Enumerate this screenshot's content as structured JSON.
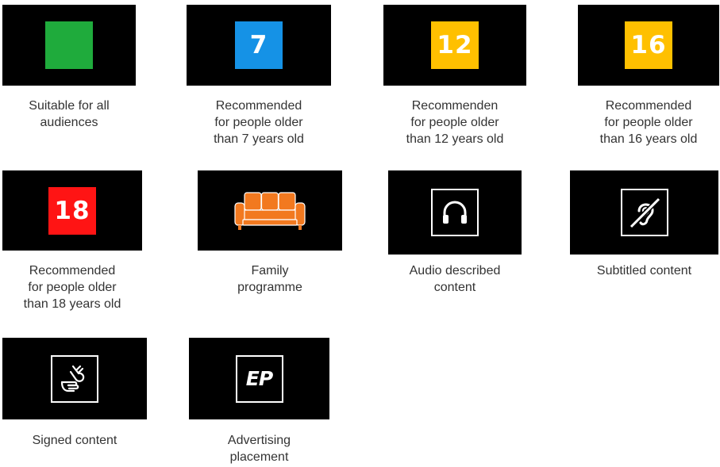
{
  "colors": {
    "green": "#1fab3c",
    "blue": "#1592e6",
    "yellow": "#ffc000",
    "red": "#ff1414",
    "sofa": "#f2791f",
    "caption": "#333333"
  },
  "items": [
    {
      "icon": "green-square-icon",
      "badge": "",
      "caption": "Suitable for all\naudiences"
    },
    {
      "icon": "rating-7-icon",
      "badge": "7",
      "caption": "Recommended\nfor people older\nthan 7 years old"
    },
    {
      "icon": "rating-12-icon",
      "badge": "12",
      "caption": "Recommenden\nfor people older\nthan 12 years old"
    },
    {
      "icon": "rating-16-icon",
      "badge": "16",
      "caption": "Recommended\nfor people older\nthan 16 years old"
    },
    {
      "icon": "rating-18-icon",
      "badge": "18",
      "caption": "Recommended\nfor people older\nthan 18 years old"
    },
    {
      "icon": "sofa-icon",
      "badge": "",
      "caption": "Family\nprogramme"
    },
    {
      "icon": "headphones-icon",
      "badge": "",
      "caption": "Audio described\ncontent"
    },
    {
      "icon": "ear-icon",
      "badge": "",
      "caption": "Subtitled content"
    },
    {
      "icon": "sign-language-icon",
      "badge": "",
      "caption": "Signed content"
    },
    {
      "icon": "ep-icon",
      "badge": "EP",
      "caption": "Advertising\nplacement"
    }
  ]
}
